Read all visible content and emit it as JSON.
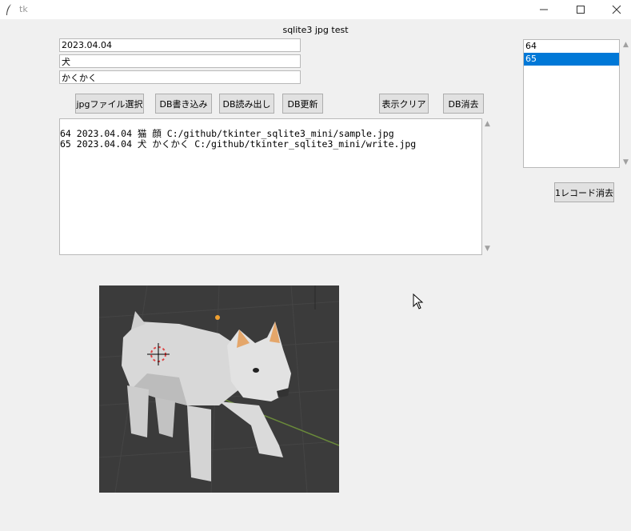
{
  "window": {
    "title": "tk"
  },
  "heading": "sqlite3 jpg test",
  "fields": {
    "date": "2023.04.04",
    "name": "犬",
    "desc": "かくかく"
  },
  "buttons": {
    "select_jpg": "jpgファイル選択",
    "db_write": "DB書き込み",
    "db_read": "DB読み出し",
    "db_update": "DB更新",
    "clear_display": "表示クリア",
    "db_delete": "DB消去",
    "delete_record": "1レコード消去"
  },
  "output_lines": [
    "64 2023.04.04 猫 顔 C:/github/tkinter_sqlite3_mini/sample.jpg",
    "65 2023.04.04 犬 かくかく C:/github/tkinter_sqlite3_mini/write.jpg"
  ],
  "list": {
    "items": [
      "64",
      "65"
    ],
    "selected": "65"
  },
  "colors": {
    "selection": "#0078d7",
    "background": "#f0f0f0",
    "image_bg": "#3b3b3b"
  }
}
